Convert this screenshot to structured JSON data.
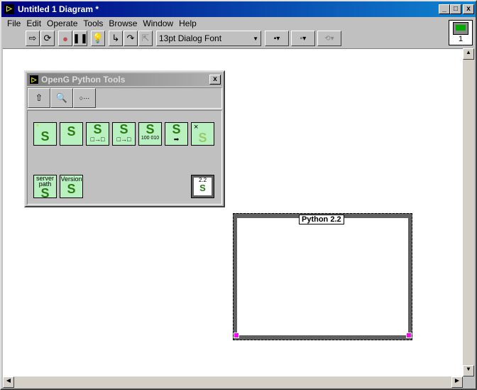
{
  "window": {
    "title": "Untitled 1 Diagram *",
    "min": "_",
    "max": "□",
    "close": "x",
    "connector_pane_label": "1"
  },
  "menu": [
    "File",
    "Edit",
    "Operate",
    "Tools",
    "Browse",
    "Window",
    "Help"
  ],
  "toolbar": {
    "font_select": "13pt Dialog Font"
  },
  "palette": {
    "title": "OpenG Python Tools",
    "close": "x",
    "items": [
      {
        "name": "python-new",
        "label": "*"
      },
      {
        "name": "python-script",
        "label": ""
      },
      {
        "name": "python-to-lv",
        "label": "□→□"
      },
      {
        "name": "lv-to-python",
        "label": "□→□"
      },
      {
        "name": "python-binary",
        "label": "100 010"
      },
      {
        "name": "python-execute",
        "label": "➡"
      },
      {
        "name": "python-close",
        "label": "×"
      },
      {
        "name": "server-path",
        "label": "server path"
      },
      {
        "name": "version",
        "label": "Version"
      },
      {
        "name": "python-22-structure",
        "label": "2.2"
      }
    ]
  },
  "diagram": {
    "structure_label": "Python 2.2",
    "terminal_color": "#ff00ff"
  }
}
